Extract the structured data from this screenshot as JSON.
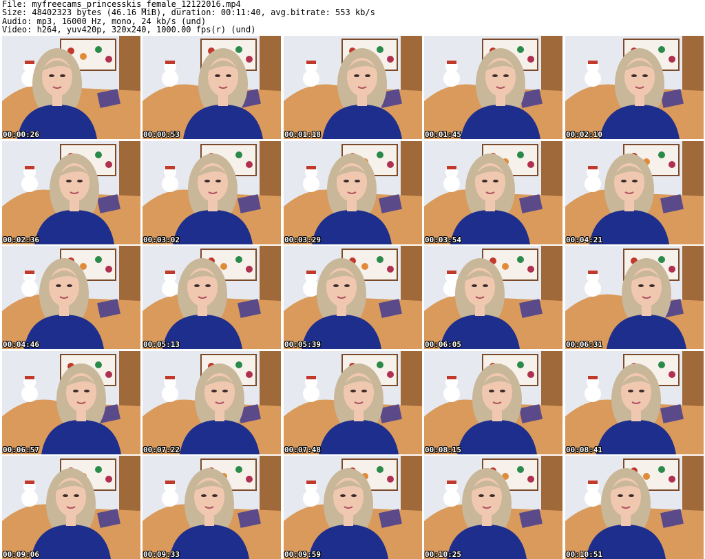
{
  "header": {
    "file_line": "File: myfreecams_princesskis_female_12122016.mp4",
    "size_line": "Size: 48402323 bytes (46.16 MiB), duration: 00:11:40, avg.bitrate: 553 kb/s",
    "audio_line": "Audio: mp3, 16000 Hz, mono, 24 kb/s (und)",
    "video_line": "Video: h264, yuv420p, 320x240, 1000.00 fps(r) (und)"
  },
  "thumbnails": [
    {
      "timestamp": "00:00:26"
    },
    {
      "timestamp": "00:00:53"
    },
    {
      "timestamp": "00:01:18"
    },
    {
      "timestamp": "00:01:45"
    },
    {
      "timestamp": "00:02:10"
    },
    {
      "timestamp": "00:02:36"
    },
    {
      "timestamp": "00:03:02"
    },
    {
      "timestamp": "00:03:29"
    },
    {
      "timestamp": "00:03:54"
    },
    {
      "timestamp": "00:04:21"
    },
    {
      "timestamp": "00:04:46"
    },
    {
      "timestamp": "00:05:13"
    },
    {
      "timestamp": "00:05:39"
    },
    {
      "timestamp": "00:06:05"
    },
    {
      "timestamp": "00:06:31"
    },
    {
      "timestamp": "00:06:57"
    },
    {
      "timestamp": "00:07:22"
    },
    {
      "timestamp": "00:07:48"
    },
    {
      "timestamp": "00:08:15"
    },
    {
      "timestamp": "00:08:41"
    },
    {
      "timestamp": "00:09:06"
    },
    {
      "timestamp": "00:09:33"
    },
    {
      "timestamp": "00:09:59"
    },
    {
      "timestamp": "00:10:25"
    },
    {
      "timestamp": "00:10:51"
    }
  ],
  "colors": {
    "background": "#ffffff",
    "wall": "#e6eaf0",
    "sofa": "#d99a5c",
    "wood": "#a0693a",
    "hair": "#c9b79a",
    "skin": "#f0c8b0",
    "top": "#1e2e8c"
  }
}
